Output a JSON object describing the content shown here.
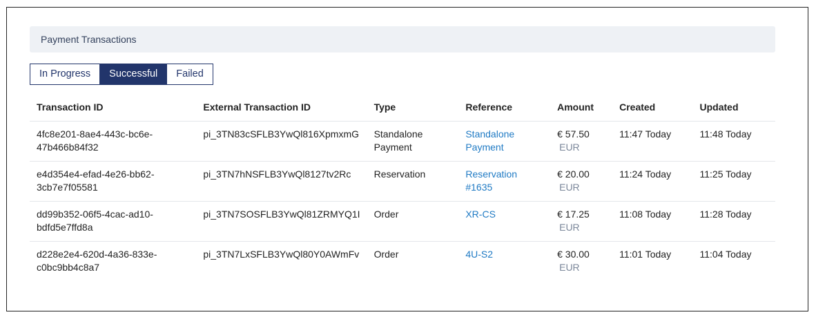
{
  "panel": {
    "title": "Payment Transactions"
  },
  "tabs": [
    {
      "label": "In Progress",
      "active": false
    },
    {
      "label": "Successful",
      "active": true
    },
    {
      "label": "Failed",
      "active": false
    }
  ],
  "table": {
    "headers": [
      "Transaction ID",
      "External Transaction ID",
      "Type",
      "Reference",
      "Amount",
      "Created",
      "Updated"
    ],
    "rows": [
      {
        "id_line1": "4fc8e201-8ae4-443c-bc6e-",
        "id_line2": "47b466b84f32",
        "external_id": "pi_3TN83cSFLB3YwQl816XpmxmG",
        "type_line1": "Standalone",
        "type_line2": "Payment",
        "ref_line1": "Standalone",
        "ref_line2": "Payment",
        "amount": "€ 57.50",
        "currency": "EUR",
        "created": "11:47 Today",
        "updated": "11:48 Today"
      },
      {
        "id_line1": "e4d354e4-efad-4e26-bb62-",
        "id_line2": "3cb7e7f05581",
        "external_id": "pi_3TN7hNSFLB3YwQl8127tv2Rc",
        "type_line1": "Reservation",
        "type_line2": "",
        "ref_line1": "Reservation #1635",
        "ref_line2": "",
        "amount": "€ 20.00",
        "currency": "EUR",
        "created": "11:24 Today",
        "updated": "11:25 Today"
      },
      {
        "id_line1": "dd99b352-06f5-4cac-ad10-",
        "id_line2": "bdfd5e7ffd8a",
        "external_id": "pi_3TN7SOSFLB3YwQl81ZRMYQ1I",
        "type_line1": "Order",
        "type_line2": "",
        "ref_line1": "XR-CS",
        "ref_line2": "",
        "amount": "€ 17.25",
        "currency": "EUR",
        "created": "11:08 Today",
        "updated": "11:28 Today"
      },
      {
        "id_line1": "d228e2e4-620d-4a36-833e-",
        "id_line2": "c0bc9bb4c8a7",
        "external_id": "pi_3TN7LxSFLB3YwQl80Y0AWmFv",
        "type_line1": "Order",
        "type_line2": "",
        "ref_line1": "4U-S2",
        "ref_line2": "",
        "amount": "€ 30.00",
        "currency": "EUR",
        "created": "11:01 Today",
        "updated": "11:04 Today"
      }
    ]
  },
  "colors": {
    "accent": "#22356b",
    "link": "#1f7ac4",
    "header_bg": "#eef1f5",
    "muted": "#7a8699"
  }
}
